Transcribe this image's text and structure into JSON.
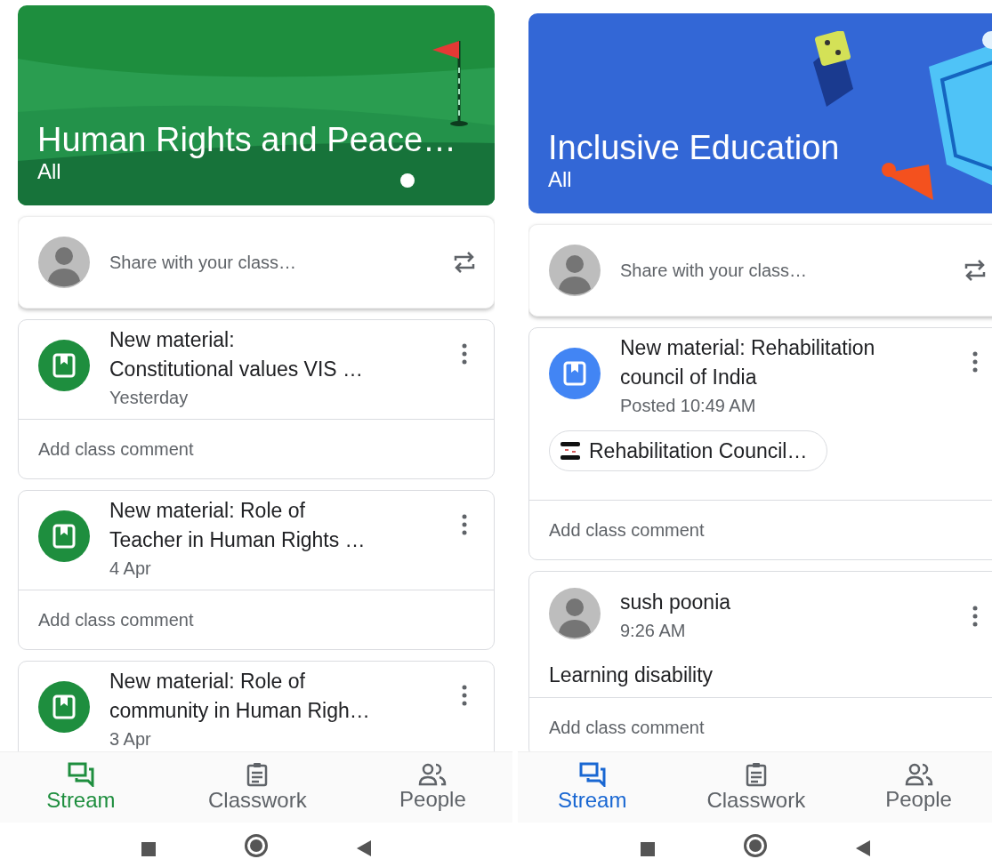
{
  "screens": [
    {
      "banner": {
        "title": "Human Rights and Peace…",
        "subtitle": "All"
      },
      "share": {
        "placeholder": "Share with your class…"
      },
      "posts": [
        {
          "kind": "material",
          "title_lines": [
            "New material:",
            "Constitutional values VIS …"
          ],
          "time": "Yesterday",
          "comment": "Add class comment"
        },
        {
          "kind": "material",
          "title_lines": [
            "New material: Role of",
            "Teacher in Human Rights …"
          ],
          "time": "4 Apr",
          "comment": "Add class comment"
        },
        {
          "kind": "material",
          "title_lines": [
            "New material: Role of",
            "community in Human Righ…"
          ],
          "time": "3 Apr"
        }
      ],
      "nav": [
        {
          "label": "Stream",
          "selected": true
        },
        {
          "label": "Classwork",
          "selected": false
        },
        {
          "label": "People",
          "selected": false
        }
      ]
    },
    {
      "banner": {
        "title": "Inclusive Education",
        "subtitle": "All"
      },
      "share": {
        "placeholder": "Share with your class…"
      },
      "posts": [
        {
          "kind": "material",
          "title_lines": [
            "New material: Rehabilitation",
            "council of India"
          ],
          "time": "Posted 10:49 AM",
          "attachment": "Rehabilitation Council…",
          "comment": "Add class comment"
        },
        {
          "kind": "announcement",
          "author": "sush poonia",
          "time": "9:26 AM",
          "body": "Learning disability",
          "comment": "Add class comment"
        }
      ],
      "nav": [
        {
          "label": "Stream",
          "selected": true
        },
        {
          "label": "Classwork",
          "selected": false
        },
        {
          "label": "People",
          "selected": false
        }
      ]
    }
  ]
}
